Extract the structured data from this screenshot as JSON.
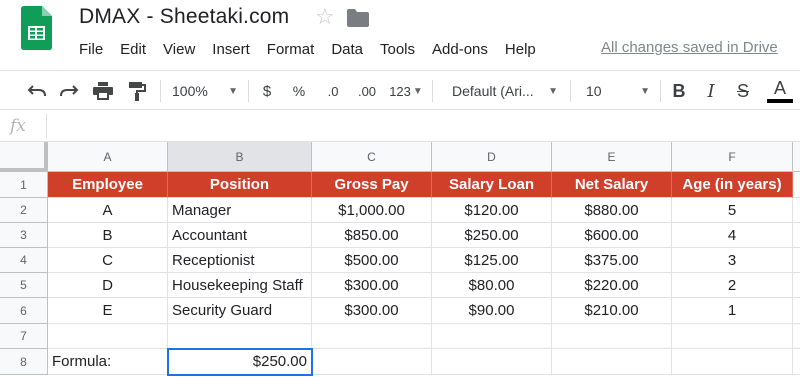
{
  "app": {
    "title": "DMAX - Sheetaki.com",
    "save_status": "All changes saved in Drive",
    "icons": {
      "logo": "google-sheets-logo",
      "star": "star-icon",
      "folder": "folder-icon"
    },
    "colors": {
      "sheets_green": "#0f9d58",
      "header_fill": "#cf3f2a",
      "selection": "#1a73e8"
    }
  },
  "menu": [
    "File",
    "Edit",
    "View",
    "Insert",
    "Format",
    "Data",
    "Tools",
    "Add-ons",
    "Help"
  ],
  "toolbar": {
    "zoom": "100%",
    "currency": "$",
    "percent": "%",
    "decrease_decimal": ".0",
    "increase_decimal": ".00",
    "more_formats": "123",
    "font": "Default (Ari...",
    "font_size": "10",
    "bold": "B",
    "italic": "I",
    "strike": "S",
    "text_color": "A"
  },
  "formula_bar": {
    "fx": "fx",
    "content": ""
  },
  "sheet": {
    "columns": [
      "A",
      "B",
      "C",
      "D",
      "E",
      "F"
    ],
    "rows": [
      "1",
      "2",
      "3",
      "4",
      "5",
      "6",
      "7",
      "8"
    ],
    "header": [
      "Employee",
      "Position",
      "Gross Pay",
      "Salary Loan",
      "Net Salary",
      "Age (in years)"
    ],
    "data": [
      [
        "A",
        "Manager",
        "$1,000.00",
        "$120.00",
        "$880.00",
        "5"
      ],
      [
        "B",
        "Accountant",
        "$850.00",
        "$250.00",
        "$600.00",
        "4"
      ],
      [
        "C",
        "Receptionist",
        "$500.00",
        "$125.00",
        "$375.00",
        "3"
      ],
      [
        "D",
        "Housekeeping Staff",
        "$300.00",
        "$80.00",
        "$220.00",
        "2"
      ],
      [
        "E",
        "Security Guard",
        "$300.00",
        "$90.00",
        "$210.00",
        "1"
      ],
      [
        "",
        "",
        "",
        "",
        "",
        ""
      ]
    ],
    "formula_row": [
      "Formula:",
      "$250.00",
      "",
      "",
      "",
      ""
    ],
    "selected_cell": "B8"
  }
}
